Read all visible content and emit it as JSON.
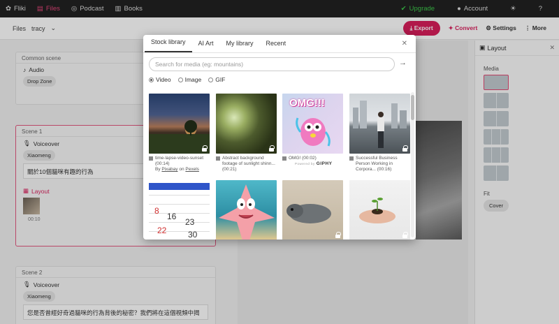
{
  "topbar": {
    "logo": "Fliki",
    "nav": [
      {
        "label": "Files",
        "icon": "file-icon",
        "active": true
      },
      {
        "label": "Podcast",
        "icon": "podcast-icon",
        "active": false
      },
      {
        "label": "Books",
        "icon": "book-icon",
        "active": false
      }
    ],
    "upgrade": "Upgrade",
    "account": "Account"
  },
  "subbar": {
    "breadcrumb_root": "Files",
    "breadcrumb_current": "tracy",
    "export": "Export",
    "convert": "Convert",
    "settings": "Settings",
    "more": "More"
  },
  "left": {
    "common_scene": {
      "title": "Common scene",
      "audio_label": "Audio",
      "drop_zone": "Drop Zone"
    },
    "scene1": {
      "title": "Scene 1",
      "play": "Pl",
      "voiceover_label": "Voiceover",
      "voice": "Xiaomeng",
      "text": "關於10個貓咪有趣的行為",
      "layout_label": "Layout",
      "clip_time": "00:10"
    },
    "scene2": {
      "title": "Scene 2",
      "voiceover_label": "Voiceover",
      "voice": "Xiaomeng",
      "text": "您是否曾經好奇過貓咪的行為背後的秘密？我們將在這個視頻中揭"
    }
  },
  "right_panel": {
    "title": "Layout",
    "media_label": "Media",
    "fit_label": "Fit",
    "fit_value": "Cover"
  },
  "modal": {
    "tabs": [
      "Stock library",
      "AI Art",
      "My library",
      "Recent"
    ],
    "search_placeholder": "Search for media (eg: mountains)",
    "media_types": [
      {
        "label": "Video",
        "selected": true
      },
      {
        "label": "Image",
        "selected": false
      },
      {
        "label": "GIF",
        "selected": false
      }
    ],
    "items": [
      {
        "caption": "time-lapse-video-sunset (00:14)",
        "by": "By",
        "author": "Pixabay",
        "on": "on",
        "source": "Pexels",
        "locked": true
      },
      {
        "caption": "Abstract background footage of sunlight shinn... (00:21)",
        "locked": true
      },
      {
        "caption": "OMG! (00:02)",
        "giphy": "GIPHY",
        "giphy_small": "Powered by",
        "thumb_text": "OMG!!!",
        "locked": false
      },
      {
        "caption": "Successful Business Person Working in Corpora... (00:16)",
        "locked": true
      },
      {
        "caption": "",
        "locked": false
      },
      {
        "caption": "",
        "locked": false
      },
      {
        "caption": "",
        "locked": true
      },
      {
        "caption": "",
        "locked": true
      }
    ]
  }
}
